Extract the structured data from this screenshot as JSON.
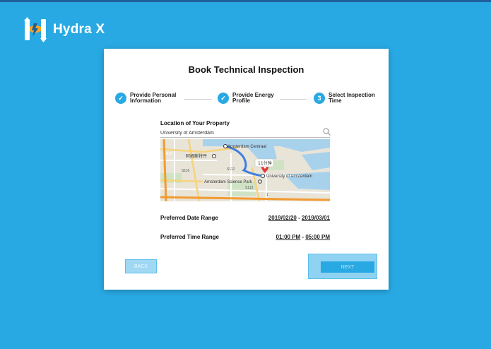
{
  "app": {
    "name": "Hydra X"
  },
  "card": {
    "title": "Book Technical Inspection",
    "steps": [
      {
        "label_line1": "Provide Personal",
        "label_line2": "Information",
        "status": "done"
      },
      {
        "label_line1": "Provide Energy",
        "label_line2": "Profile",
        "status": "done"
      },
      {
        "label_line1": "Select Inspection",
        "label_line2": "Time",
        "status": "current",
        "number": "3"
      }
    ],
    "location": {
      "label": "Location of Your Property",
      "value": "University of Amsterdam"
    },
    "map": {
      "labels": {
        "centraal": "Amsterdam Centraal",
        "station": "阿姆斯特丹",
        "science_park": "Amsterdam Science Park",
        "university": "University of Amsterdam",
        "route_time": "11分钟",
        "road_a10": "A10",
        "road_s116": "S116",
        "road_s112": "S112",
        "road_s113": "S113",
        "poi": "1"
      }
    },
    "date_range": {
      "label": "Preferred Date Range",
      "start": "2019/02/20",
      "sep": " - ",
      "end": "2019/03/01"
    },
    "time_range": {
      "label": "Preferred Time Range",
      "start": "01:00 PM",
      "sep": " - ",
      "end": "05:00 PM"
    },
    "buttons": {
      "back": "BACK",
      "next": "NEXT"
    }
  },
  "colors": {
    "background": "#29a9e3",
    "accent": "#29a9e3",
    "card": "#ffffff"
  }
}
